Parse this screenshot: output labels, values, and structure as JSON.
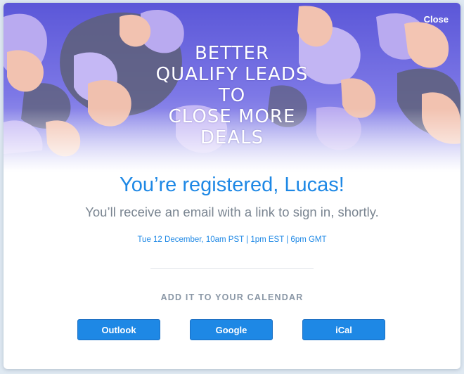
{
  "modal": {
    "close_label": "Close",
    "hero_lines": [
      "BETTER",
      "QUALIFY LEADS",
      "TO",
      "CLOSE MORE",
      "DEALS"
    ],
    "title": "You’re registered, Lucas!",
    "subtitle": "You’ll receive an email with a link to sign in, shortly.",
    "datetime": "Tue 12 December, 10am PST | 1pm EST | 6pm GMT",
    "calendar_heading": "ADD IT TO YOUR CALENDAR",
    "buttons": {
      "outlook": "Outlook",
      "google": "Google",
      "ical": "iCal"
    }
  },
  "colors": {
    "accent": "#1e88e5",
    "hero_purple": "#7b73e0",
    "blob_lavender": "#b9aaf0",
    "blob_peach": "#f2c2b0",
    "blob_gray": "#6b6e86"
  }
}
